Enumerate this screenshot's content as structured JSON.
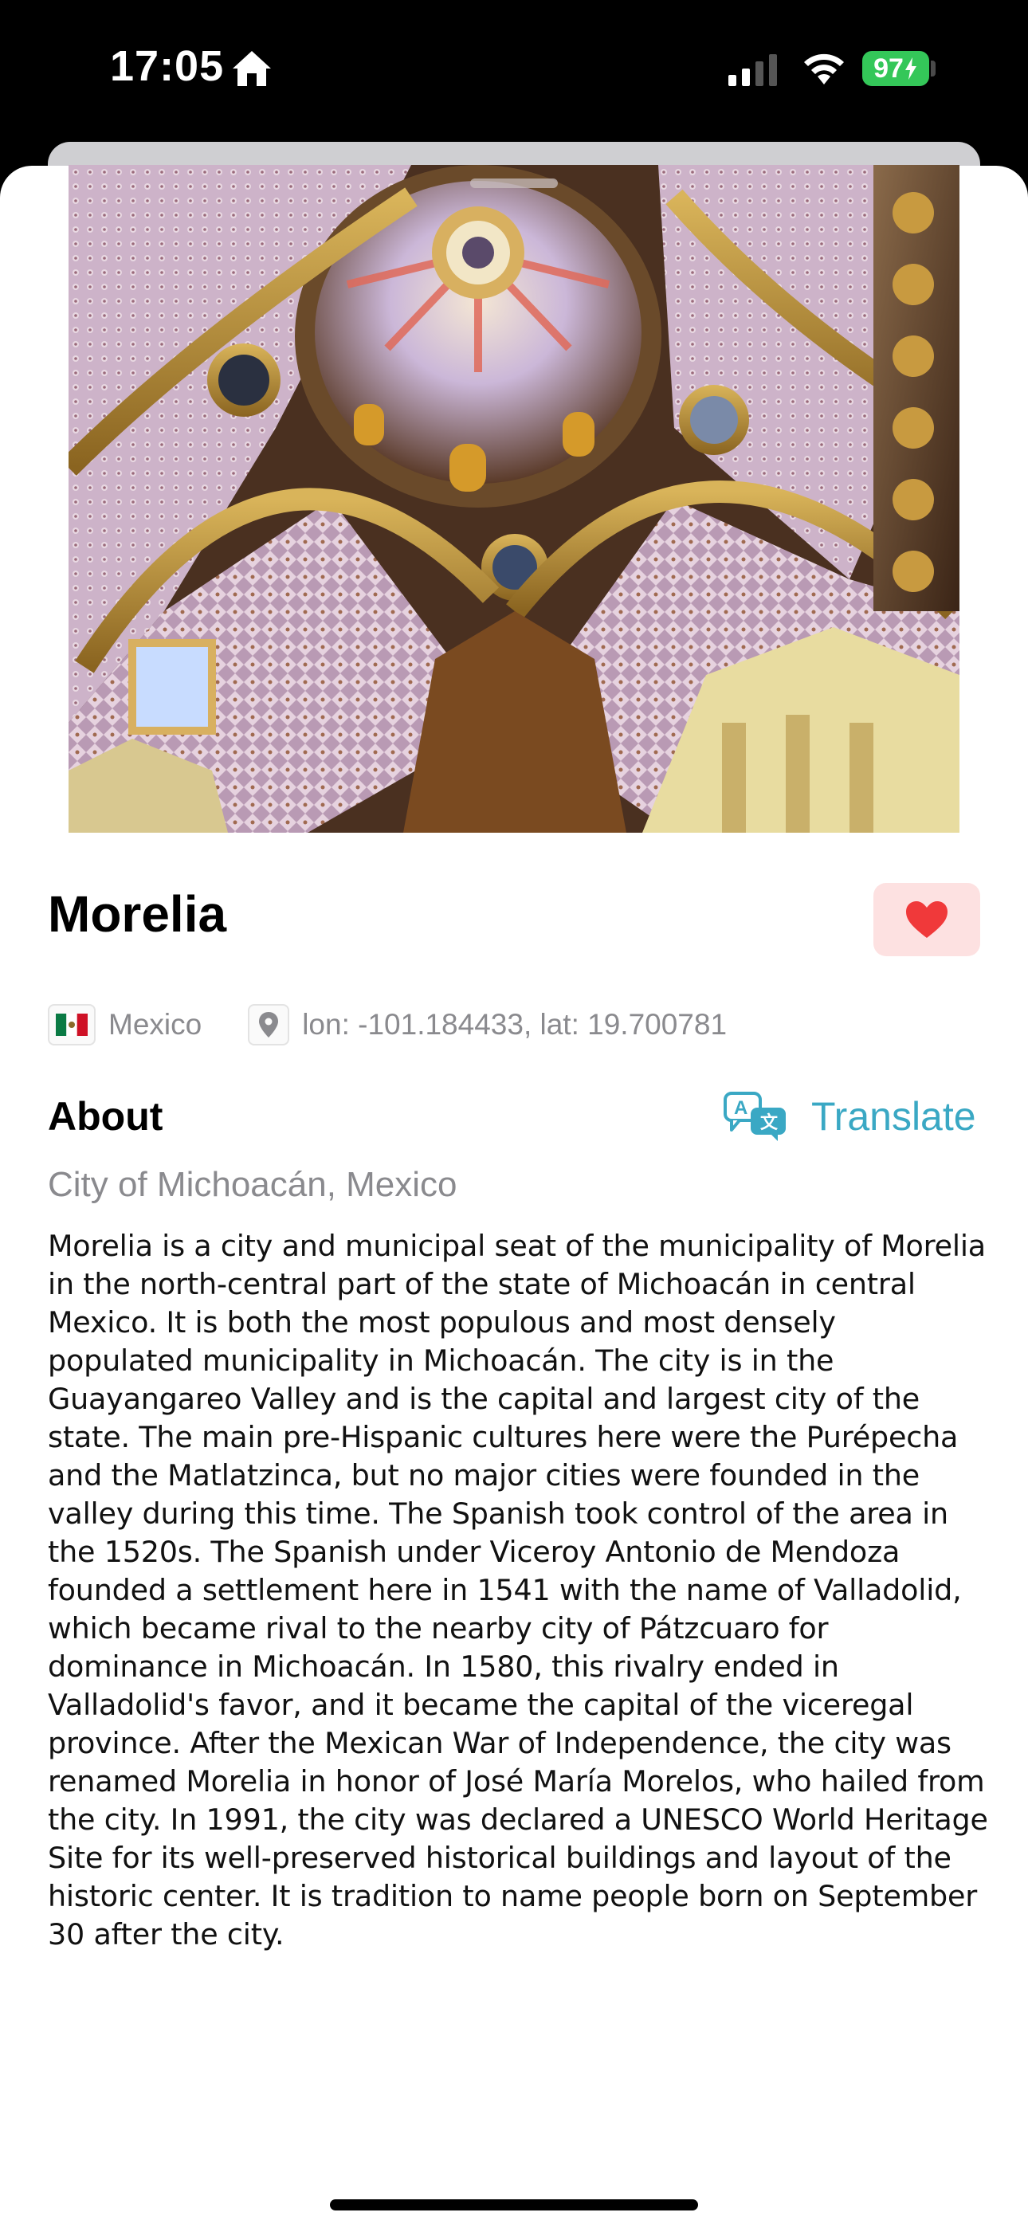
{
  "status_bar": {
    "time": "17:05",
    "battery": "97",
    "icons": [
      "home-icon",
      "signal-icon",
      "wifi-icon",
      "battery-icon"
    ]
  },
  "city": {
    "name": "Morelia",
    "country": "Mexico",
    "coordinates": "lon: -101.184433, lat: 19.700781",
    "favorite": true
  },
  "about": {
    "heading": "About",
    "translate_label": "Translate",
    "subtitle": "City of Michoacán, Mexico",
    "description": "Morelia is a city and municipal seat of the municipality of Morelia in the north-central part of the state of Michoacán in central Mexico. It is both the most populous and most densely populated municipality in Michoacán. The city is in the Guayangareo Valley and is the capital and largest city of the state. The main pre-Hispanic cultures here were the Purépecha and the Matlatzinca, but no major cities were founded in the valley during this time. The Spanish took control of the area in the 1520s. The Spanish under Viceroy Antonio de Mendoza founded a settlement here in 1541 with the name of Valladolid, which became rival to the nearby city of Pátzcuaro for dominance in Michoacán. In 1580, this rivalry ended in Valladolid's favor, and it became the capital of the viceregal province. After the Mexican War of Independence, the city was renamed Morelia in honor of José María Morelos, who hailed from the city. In 1991, the city was declared a UNESCO World Heritage Site for its well-preserved historical buildings and layout of the historic center. It is tradition to name people born on September 30 after the city."
  },
  "colors": {
    "accent": "#3aa8c4",
    "heart": "#f0393a",
    "fav_bg": "#fde1e1",
    "secondary_text": "#8a8a8e"
  }
}
